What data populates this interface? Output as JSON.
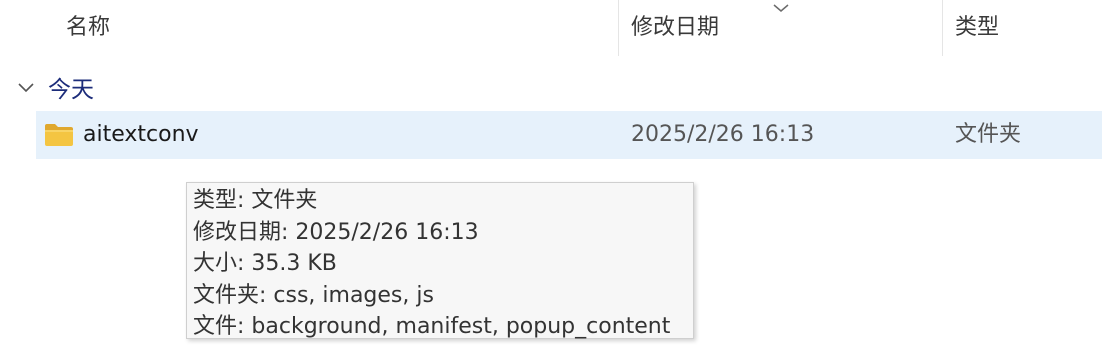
{
  "columns": {
    "name": "名称",
    "date": "修改日期",
    "type": "类型"
  },
  "sort_indicator_icon": "chevron-down-icon",
  "group": {
    "label": "今天",
    "expanded": true
  },
  "rows": [
    {
      "icon": "folder-icon",
      "name": "aitextconv",
      "date": "2025/2/26 16:13",
      "type": "文件夹",
      "selected": true
    }
  ],
  "tooltip": {
    "lines": [
      "类型: 文件夹",
      "修改日期: 2025/2/26 16:13",
      "大小: 35.3 KB",
      "文件夹: css, images, js",
      "文件: background, manifest, popup_content"
    ]
  },
  "colors": {
    "selection_bg": "#e6f1fb",
    "group_label": "#1c2c7a",
    "folder_yellow": "#f4c542",
    "tooltip_bg": "#f7f7f7"
  }
}
